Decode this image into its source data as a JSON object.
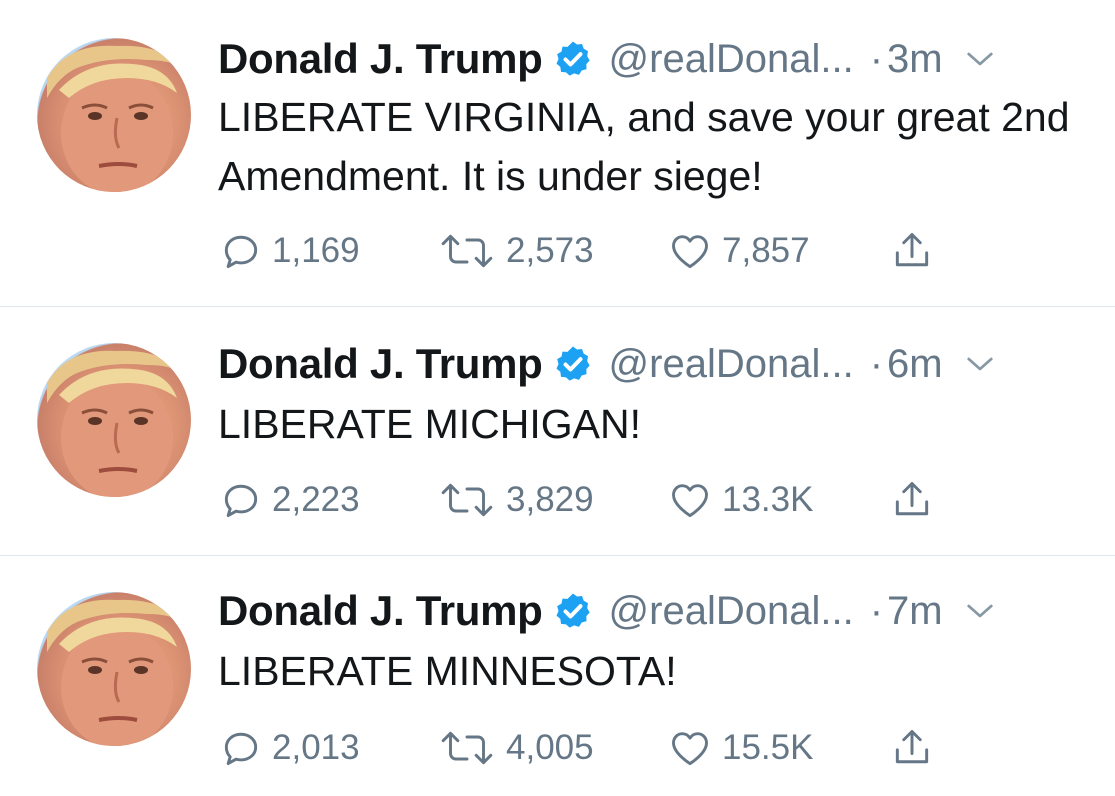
{
  "tweets": [
    {
      "name": "Donald J. Trump",
      "handle": "@realDonal...",
      "separator": "·",
      "time": "3m",
      "text": "LIBERATE VIRGINIA, and save your great 2nd Amendment. It is under siege!",
      "replies": "1,169",
      "retweets": "2,573",
      "likes": "7,857"
    },
    {
      "name": "Donald J. Trump",
      "handle": "@realDonal...",
      "separator": "·",
      "time": "6m",
      "text": "LIBERATE MICHIGAN!",
      "replies": "2,223",
      "retweets": "3,829",
      "likes": "13.3K"
    },
    {
      "name": "Donald J. Trump",
      "handle": "@realDonal...",
      "separator": "·",
      "time": "7m",
      "text": "LIBERATE MINNESOTA!",
      "replies": "2,013",
      "retweets": "4,005",
      "likes": "15.5K"
    }
  ],
  "icons": {
    "verified": "verified-badge-icon",
    "caret": "chevron-down-icon",
    "reply": "reply-icon",
    "retweet": "retweet-icon",
    "like": "heart-icon",
    "share": "share-icon"
  },
  "colors": {
    "verified": "#1da1f2",
    "secondary_text": "#657786",
    "primary_text": "#14171a",
    "divider": "#e1e8ed"
  }
}
